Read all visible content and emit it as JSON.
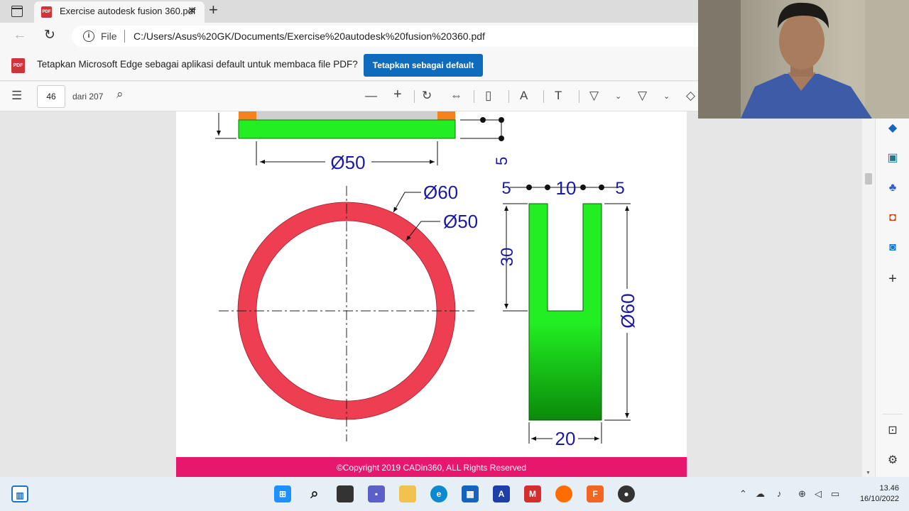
{
  "browser": {
    "tab_title": "Exercise autodesk fusion 360.pdf",
    "address_scheme": "File",
    "url": "C:/Users/Asus%20GK/Documents/Exercise%20autodesk%20fusion%20360.pdf"
  },
  "notification": {
    "message": "Tetapkan Microsoft Edge sebagai aplikasi default untuk membaca file PDF?",
    "button": "Tetapkan sebagai default"
  },
  "pdf_toolbar": {
    "page_number": "46",
    "page_total": "dari 207"
  },
  "drawing": {
    "dim_top_diameter": "Ø50",
    "dim_5_vertical": "5",
    "dim_outer_diameter": "Ø60",
    "dim_inner_diameter": "Ø50",
    "dim_left_5": "5",
    "dim_10": "10",
    "dim_right_5": "5",
    "dim_30": "30",
    "dim_side_diameter": "Ø60",
    "dim_20": "20",
    "colors": {
      "ring": "#ee3f52",
      "green": "#22ee22",
      "green_dark": "#0a8a0a",
      "orange": "#f5821f",
      "dim": "#1a1aa6"
    }
  },
  "copyright": "©Copyright 2019 CADin360, ALL Rights Reserved",
  "taskbar": {
    "time": "13.46",
    "date": "16/10/2022"
  }
}
